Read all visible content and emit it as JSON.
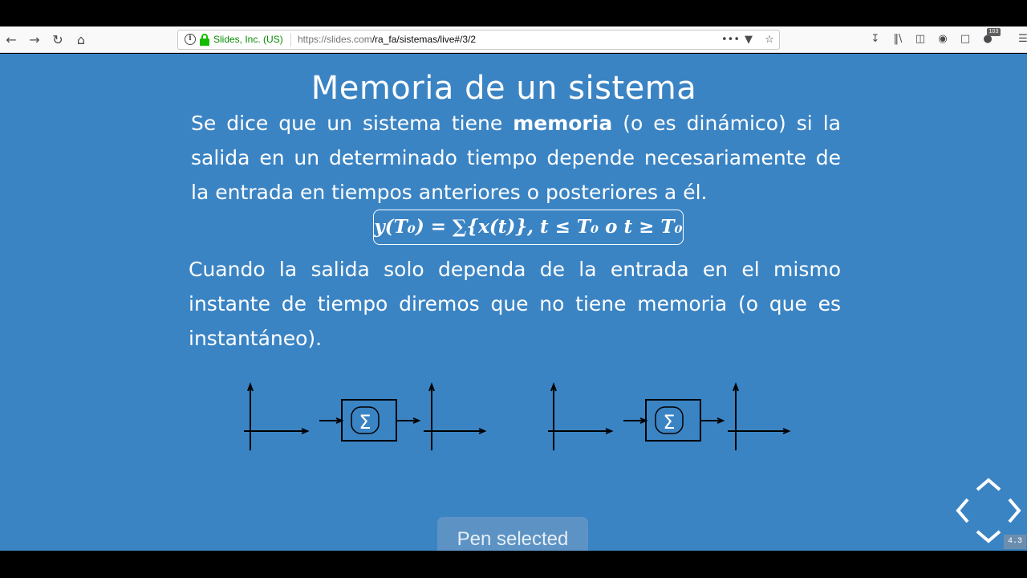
{
  "browser": {
    "identity": "Slides, Inc. (US)",
    "url_host": "https://slides.com",
    "url_path": "/ra_fa/sistemas/live#/3/2",
    "badge": "103",
    "icons": {
      "back": "back-arrow-icon",
      "forward": "forward-arrow-icon",
      "reload": "reload-icon",
      "home": "home-icon",
      "info": "info-icon",
      "lock": "lock-icon",
      "more": "more-icon",
      "pocket": "pocket-icon",
      "bookmark": "star-icon",
      "download": "download-icon",
      "library": "library-icon",
      "sidebar": "sidebar-icon",
      "extension": "extension-icon",
      "menu": "menu-icon"
    },
    "colors": {
      "secure": "#12bc00"
    }
  },
  "slide": {
    "title": "Memoria de un sistema",
    "para1_before": "Se dice que un sistema tiene ",
    "para1_bold": "memoria",
    "para1_after": " (o es dinámico) si la salida en un determinado tiempo depende necesariamente de la entrada en tiempos anteriores o posteriores a él.",
    "formula": "y(T₀) = ∑{x(t)},  t ≤ T₀ o t ≥ T₀",
    "para2": "Cuando la salida solo dependa de la entrada en el mismo instante de tiempo diremos que no tiene memoria (o que es instantáneo).",
    "diagram_symbol": "Σ",
    "background": "#3b84c4"
  },
  "toast": {
    "text": "Pen selected"
  },
  "navigation": {
    "page": "4.3",
    "icons": [
      "nav-up-icon",
      "nav-left-icon",
      "nav-right-icon",
      "nav-down-icon"
    ]
  }
}
